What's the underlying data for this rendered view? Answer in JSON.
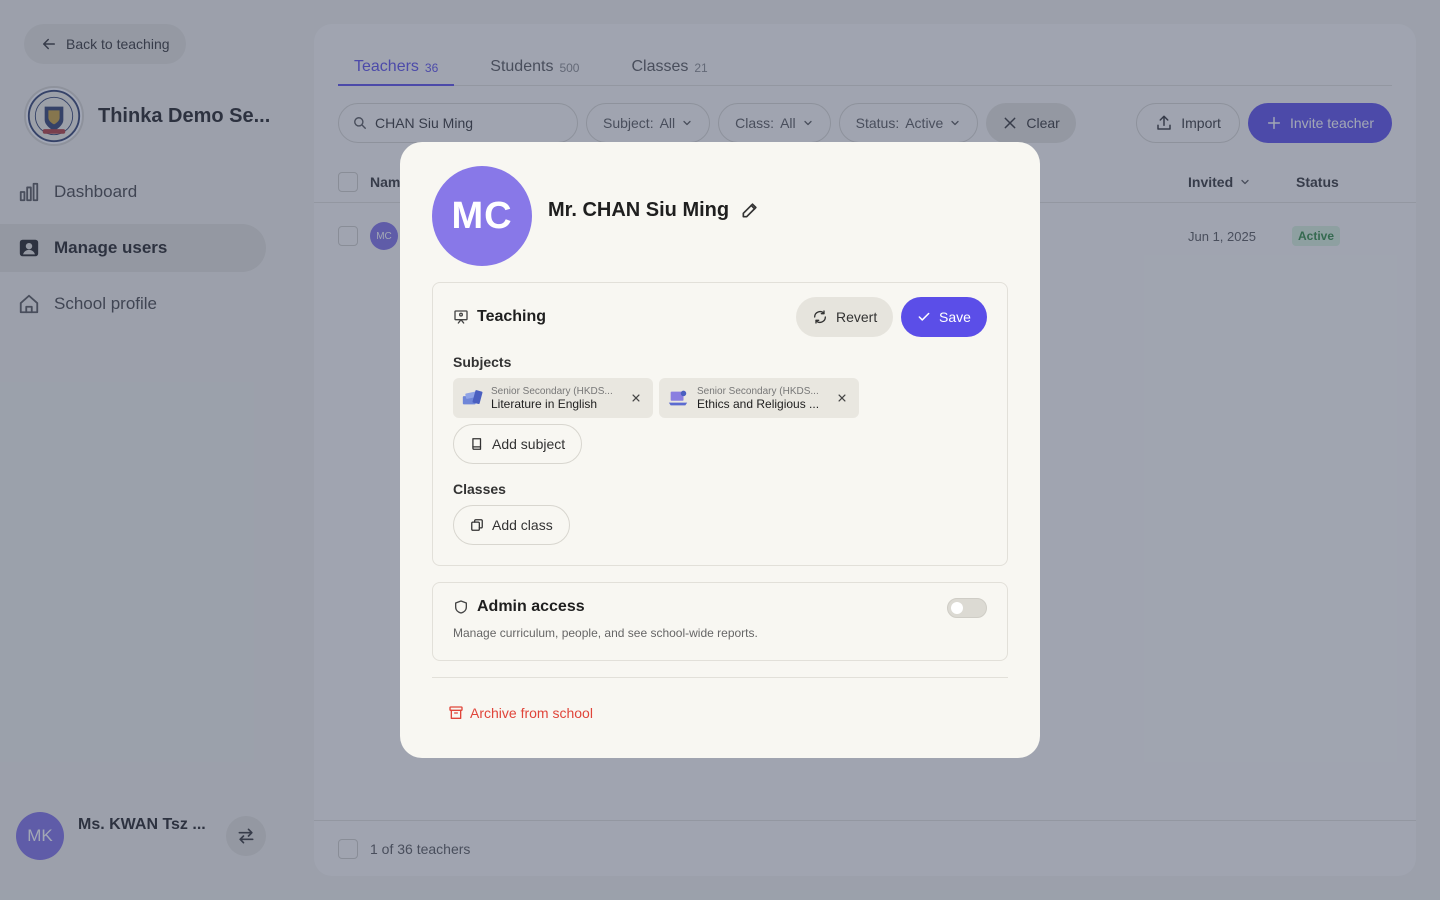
{
  "sidebar": {
    "back_label": "Back to teaching",
    "school_name": "Thinka Demo Se...",
    "nav": [
      {
        "label": "Dashboard",
        "icon": "bar-chart-icon"
      },
      {
        "label": "Manage users",
        "icon": "user-square-icon",
        "active": true
      },
      {
        "label": "School profile",
        "icon": "home-icon"
      }
    ],
    "user": {
      "initials": "MK",
      "name": "Ms. KWAN Tsz ..."
    }
  },
  "main": {
    "tabs": [
      {
        "label": "Teachers",
        "count": "36",
        "active": true
      },
      {
        "label": "Students",
        "count": "500"
      },
      {
        "label": "Classes",
        "count": "21"
      }
    ],
    "search_value": "CHAN Siu Ming",
    "filters": [
      {
        "label": "Subject:",
        "value": "All"
      },
      {
        "label": "Class:",
        "value": "All"
      },
      {
        "label": "Status:",
        "value": "Active"
      }
    ],
    "clear_label": "Clear",
    "import_label": "Import",
    "invite_label": "Invite teacher",
    "table": {
      "headers": {
        "name": "Nam",
        "invited": "Invited",
        "status": "Status"
      },
      "rows": [
        {
          "initials": "MC",
          "invited": "Jun 1, 2025",
          "status": "Active"
        }
      ],
      "footer": "1 of 36 teachers"
    }
  },
  "modal": {
    "initials": "MC",
    "name": "Mr. CHAN Siu Ming",
    "teaching": {
      "title": "Teaching",
      "revert_label": "Revert",
      "save_label": "Save",
      "subjects_label": "Subjects",
      "subjects": [
        {
          "category": "Senior Secondary (HKDS...",
          "name": "Literature in English"
        },
        {
          "category": "Senior Secondary (HKDS...",
          "name": "Ethics and Religious ..."
        }
      ],
      "add_subject_label": "Add subject",
      "classes_label": "Classes",
      "add_class_label": "Add class"
    },
    "admin": {
      "title": "Admin access",
      "description": "Manage curriculum, people, and see school-wide reports.",
      "enabled": false
    },
    "archive_label": "Archive from school"
  },
  "colors": {
    "accent": "#5b4ee8",
    "avatar": "#8878e8",
    "danger": "#e0453a",
    "status_active_bg": "#d9f1d9",
    "status_active_text": "#2f8a3e"
  }
}
